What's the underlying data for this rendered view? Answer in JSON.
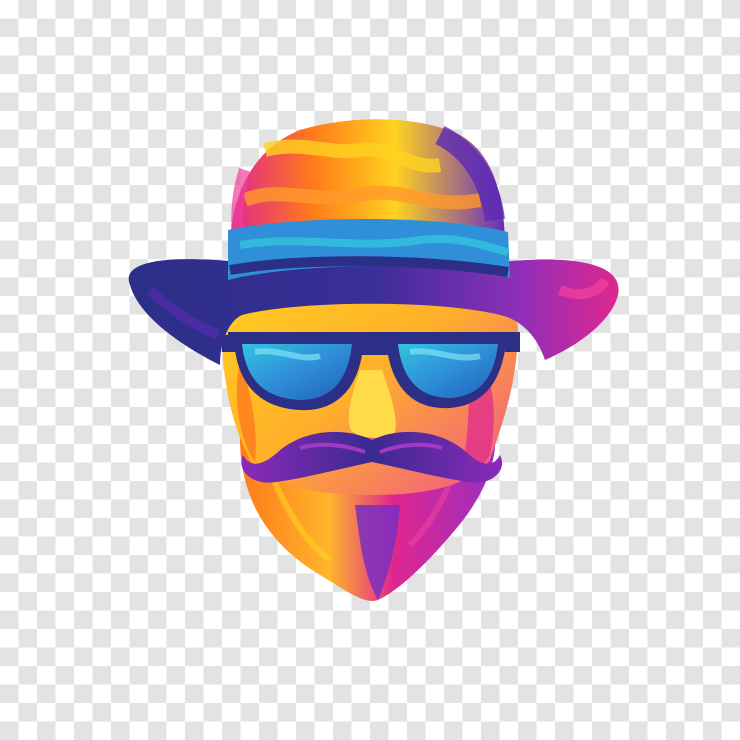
{
  "background": {
    "pattern": "transparency-checkerboard",
    "light_color": "#ffffff",
    "dark_color": "#e3e3e3"
  },
  "illustration": {
    "subject": "hipster-head",
    "items": [
      "hat",
      "hat-band",
      "sunglasses",
      "mustache",
      "beard"
    ],
    "colors": {
      "purple": "#5b2bb3",
      "navy": "#2b2f86",
      "magenta": "#e0268f",
      "pink": "#f03f9c",
      "orange": "#ff7a1a",
      "yellow": "#ffd21f",
      "blue": "#2f8fd8",
      "cyan": "#34c3e0"
    }
  }
}
